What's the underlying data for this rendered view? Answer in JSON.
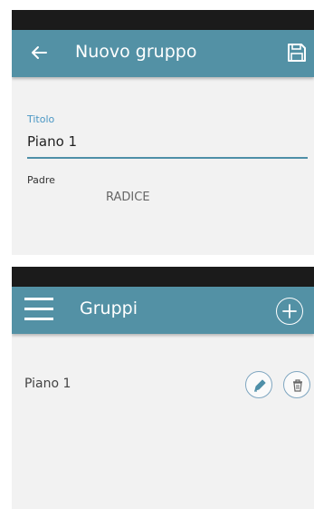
{
  "new_group": {
    "title": "Nuovo gruppo",
    "field_title_label": "Titolo",
    "field_title_value": "Piano 1",
    "field_parent_label": "Padre",
    "field_parent_value": "RADICE",
    "icons": {
      "back": "arrow-left-icon",
      "save": "floppy-disk-icon"
    }
  },
  "groups": {
    "title": "Gruppi",
    "items": [
      {
        "label": "Piano 1"
      }
    ],
    "icons": {
      "menu": "hamburger-icon",
      "add": "plus-circle-icon",
      "edit": "pencil-icon",
      "delete": "trash-icon"
    }
  },
  "colors": {
    "appbar": "#5391a5",
    "statusbar": "#1b1b1b",
    "accent_label": "#4a97c4",
    "background": "#f2f2f2"
  }
}
